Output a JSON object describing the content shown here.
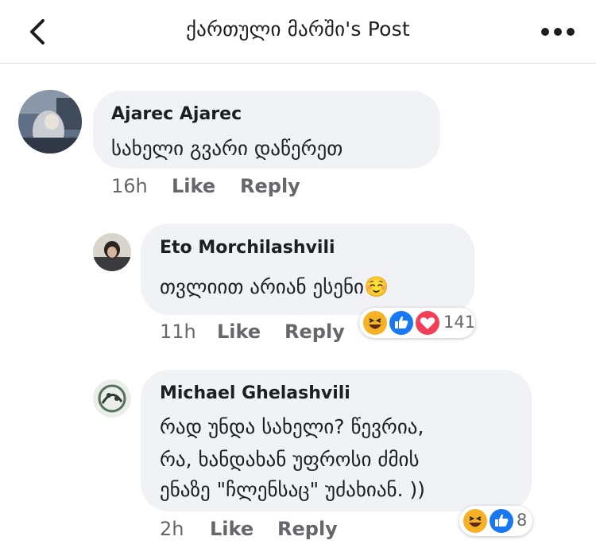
{
  "header": {
    "title": "ქართული მარში's Post"
  },
  "comments": [
    {
      "author": "Ajarec Ajarec",
      "text_lines": [
        "სახელი გვარი დაწერეთ"
      ],
      "time": "16h",
      "like_label": "Like",
      "reply_label": "Reply"
    },
    {
      "author": "Eto Morchilashvili",
      "text_lines": [
        "თვლიით არიან ესენი☺️"
      ],
      "time": "11h",
      "like_label": "Like",
      "reply_label": "Reply",
      "reactions": {
        "types": [
          "haha",
          "like",
          "love"
        ],
        "count": "141"
      }
    },
    {
      "author": "Michael Ghelashvili",
      "text_lines": [
        "რად უნდა სახელი? წევრია,",
        "რა, ხანდახან უფროსი ძმის",
        "ენაზე \"ჩლენსაც\" უძახიან. ))"
      ],
      "time": "2h",
      "like_label": "Like",
      "reply_label": "Reply",
      "reactions": {
        "types": [
          "haha",
          "like"
        ],
        "count": "8"
      }
    }
  ],
  "colors": {
    "like_blue": "#1877f2",
    "love_red": "#f33e58",
    "haha_yellow": "#f7b125",
    "bubble_bg": "#f0f2f5",
    "meta_gray": "#65676b"
  }
}
